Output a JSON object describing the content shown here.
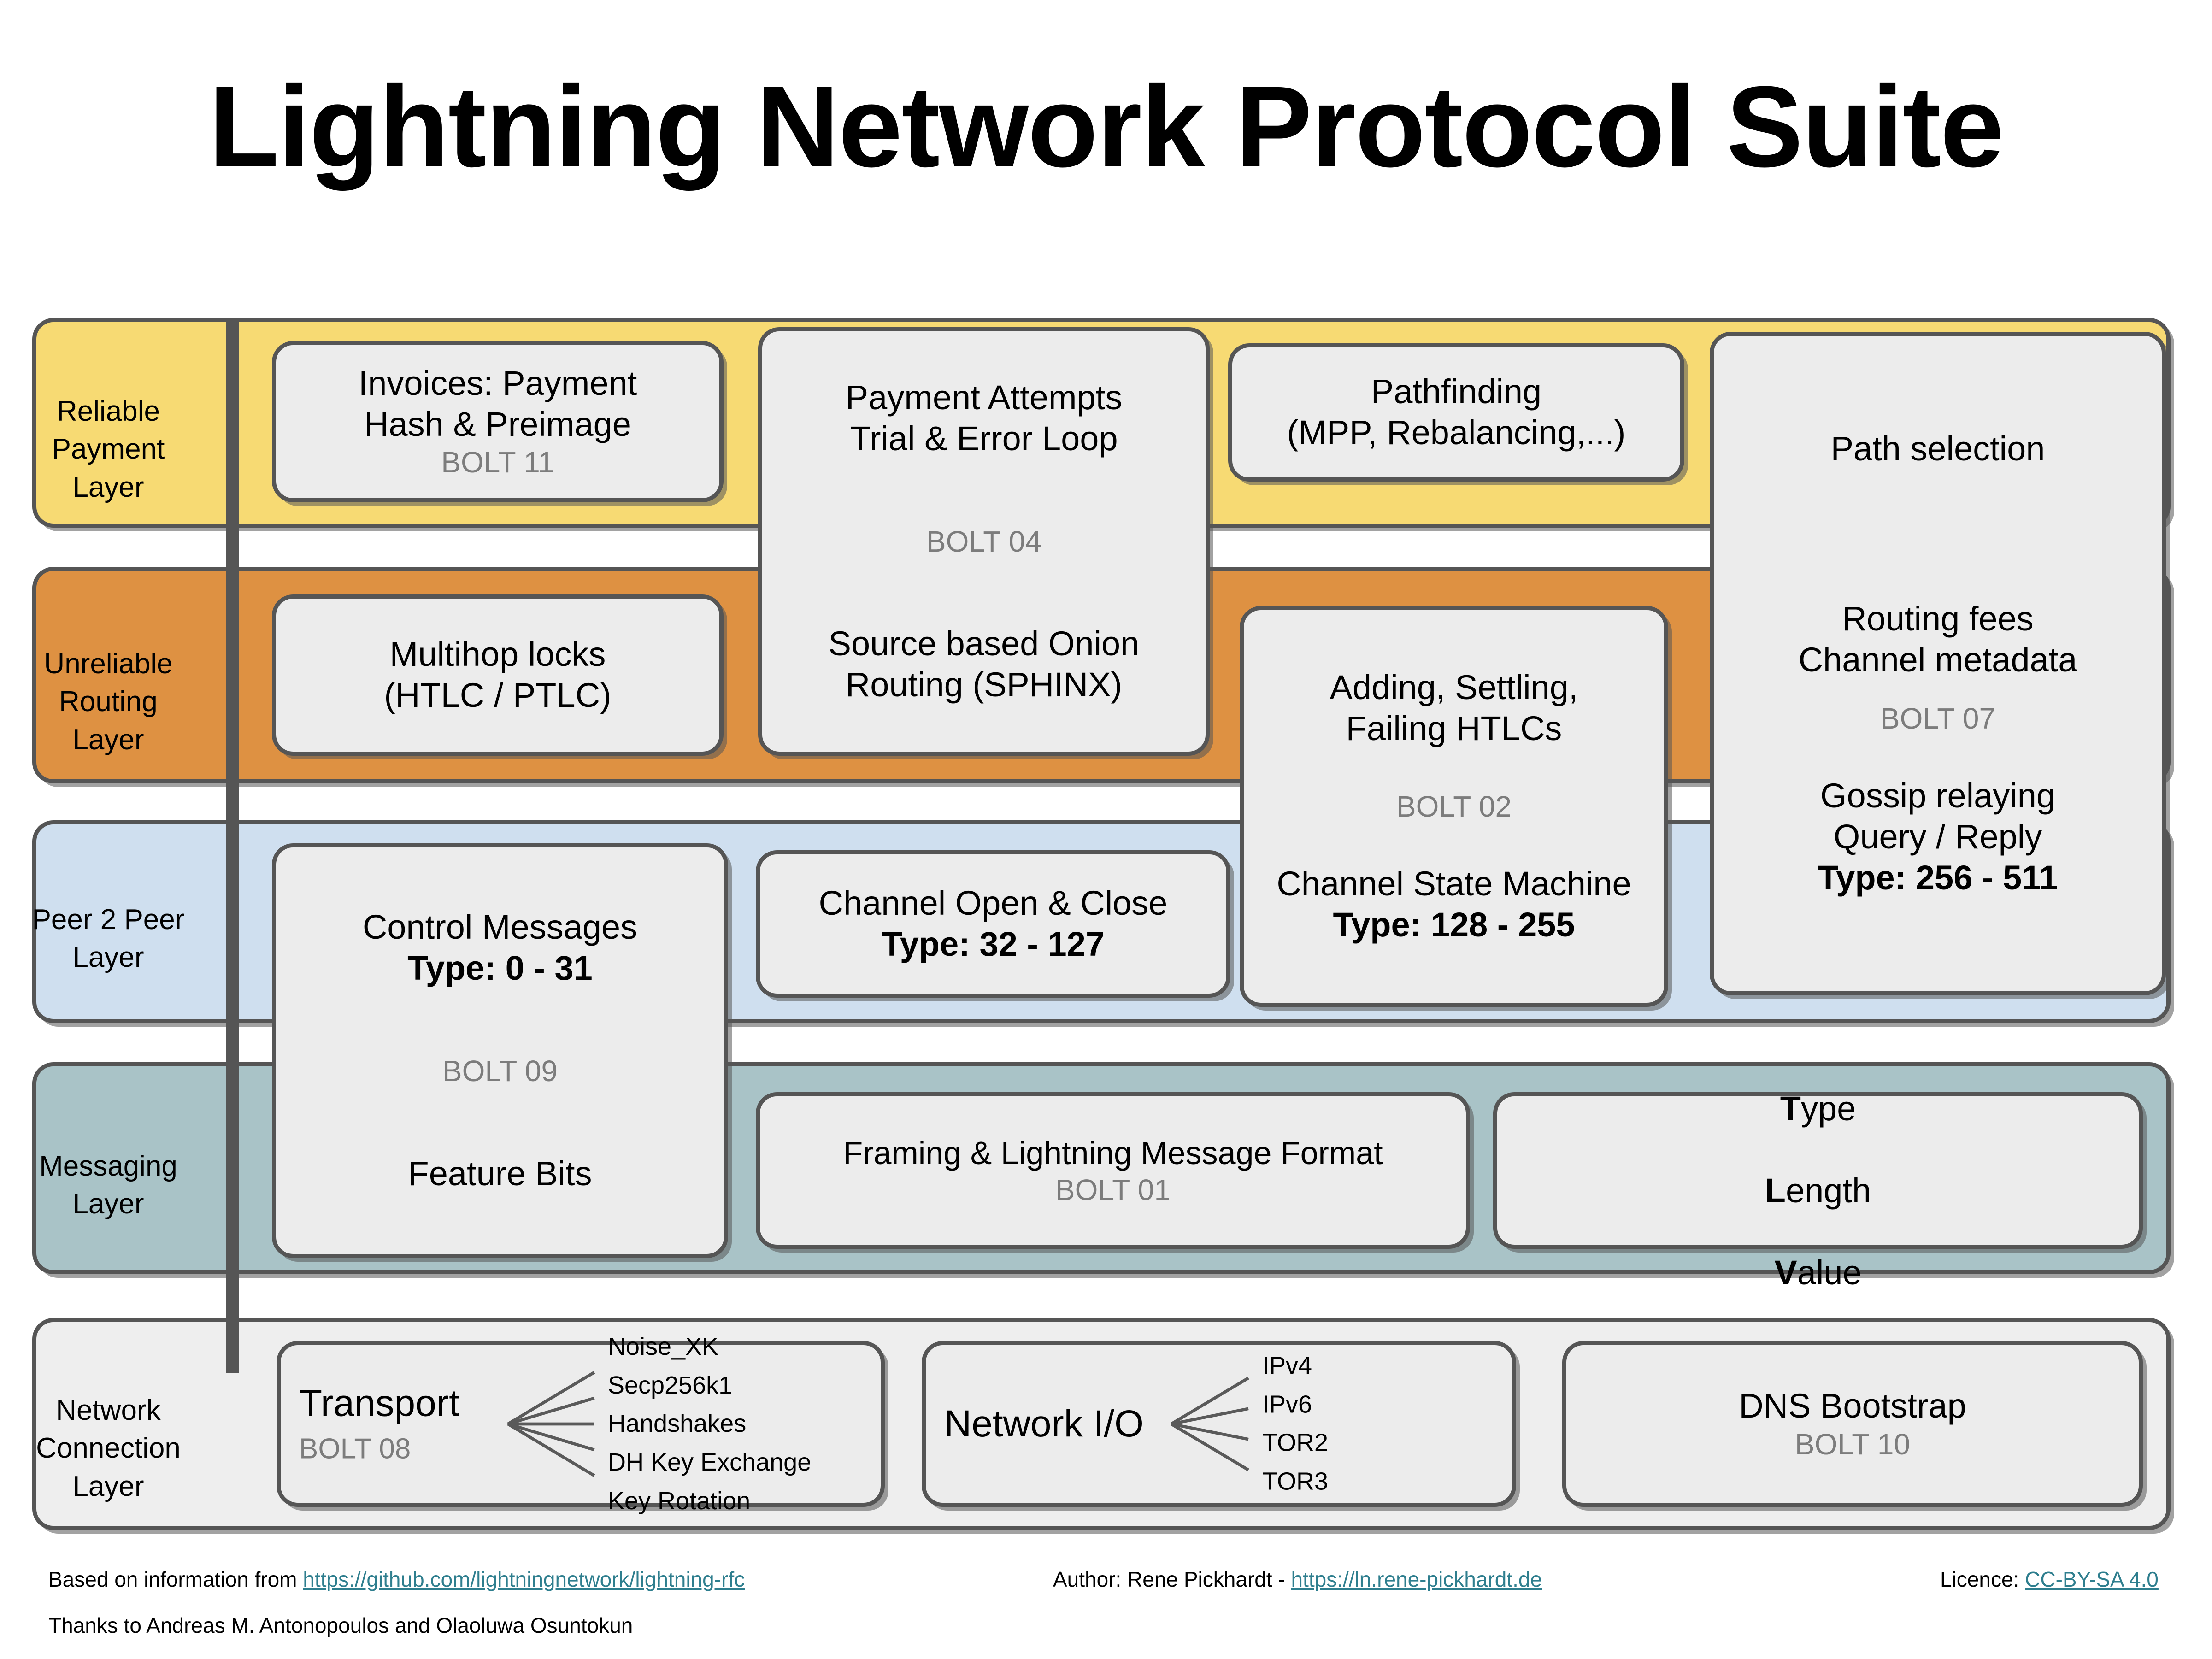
{
  "title": "Lightning Network Protocol Suite",
  "layers": [
    {
      "id": "reliable-payment",
      "label": "Reliable\nPayment\nLayer",
      "color": "#F7DA73"
    },
    {
      "id": "unreliable-routing",
      "label": "Unreliable\nRouting\nLayer",
      "color": "#DE9142"
    },
    {
      "id": "peer-2-peer",
      "label": "Peer 2 Peer\nLayer",
      "color": "#CFDFEF"
    },
    {
      "id": "messaging",
      "label": "Messaging\nLayer",
      "color": "#A9C3C7"
    },
    {
      "id": "network-connection",
      "label": "Network\nConnection\nLayer",
      "color": "#EEEEEE"
    }
  ],
  "boxes": {
    "invoices": {
      "title": "Invoices: Payment\nHash & Preimage",
      "bolt": "BOLT 11"
    },
    "payment_attempts": {
      "title": "Payment Attempts\nTrial & Error Loop",
      "bolt": "BOLT 04",
      "title2": "Source based Onion\nRouting (SPHINX)"
    },
    "pathfinding": {
      "title": "Pathfinding\n(MPP, Rebalancing,...)"
    },
    "path_selection": {
      "title": "Path selection",
      "title2": "Routing fees\nChannel metadata",
      "bolt": "BOLT 07",
      "title3": "Gossip relaying\nQuery / Reply",
      "type": "Type: 256 - 511"
    },
    "multihop_locks": {
      "title": "Multihop locks\n(HTLC / PTLC)"
    },
    "htlcs": {
      "title": "Adding, Settling,\nFailing HTLCs",
      "bolt": "BOLT 02",
      "title2": "Channel State Machine",
      "type": "Type: 128 - 255"
    },
    "control_messages": {
      "title": "Control Messages",
      "type": "Type: 0 - 31",
      "bolt": "BOLT 09",
      "title2": "Feature Bits"
    },
    "channel_open": {
      "title": "Channel Open & Close",
      "type": "Type: 32 - 127"
    },
    "framing": {
      "title": "Framing & Lightning Message Format",
      "bolt": "BOLT 01"
    },
    "tlv": {
      "line1_bold": "T",
      "line1_rest": "ype",
      "line2_bold": "L",
      "line2_rest": "ength",
      "line3_bold": "V",
      "line3_rest": "alue"
    },
    "transport": {
      "title": "Transport",
      "bolt": "BOLT 08",
      "items": [
        "Noise_XK",
        "Secp256k1",
        "Handshakes",
        "DH Key Exchange",
        "Key Rotation"
      ]
    },
    "network_io": {
      "title": "Network I/O",
      "items": [
        "IPv4",
        "IPv6",
        "TOR2",
        "TOR3"
      ]
    },
    "dns_bootstrap": {
      "title": "DNS Bootstrap",
      "bolt": "BOLT 10"
    }
  },
  "footer": {
    "source_prefix": "Based on information from ",
    "source_link": "https://github.com/lightningnetwork/lightning-rfc",
    "thanks": "Thanks to Andreas M. Antonopoulos and Olaoluwa Osuntokun",
    "author_prefix": "Author: Rene Pickhardt - ",
    "author_link": "https://ln.rene-pickhardt.de",
    "licence_prefix": "Licence: ",
    "licence_link": "CC-BY-SA 4.0"
  },
  "colors": {
    "stroke": "#555555",
    "box_fill": "#ECECEC",
    "bolt_text": "#7C7C7C",
    "link": "#2E7E8E"
  }
}
